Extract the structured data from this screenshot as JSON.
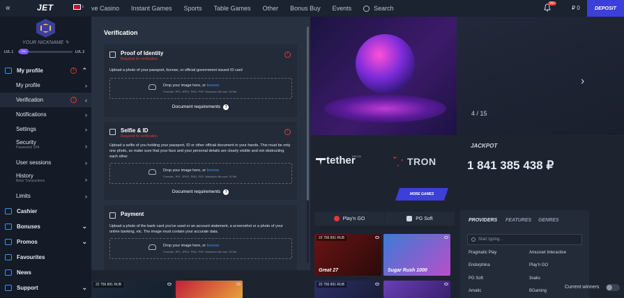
{
  "header": {
    "logo": "JET",
    "nav": [
      "ve Casino",
      "Instant Games",
      "Sports",
      "Table Games",
      "Other",
      "Bonus Buy",
      "Events"
    ],
    "search": "Search",
    "notif_badge": "99+",
    "balance": "₽ 0",
    "deposit": "DEPOSIT"
  },
  "profile": {
    "nickname": "YOUR NICKNAME",
    "lvl_left": "LVL 1",
    "lvl_right": "LVL 2",
    "lvl_pill": "0%",
    "progress": 0.07
  },
  "sidebar": {
    "my_profile": "My profile",
    "sub": [
      {
        "label": "My profile"
      },
      {
        "label": "Verification"
      },
      {
        "label": "Notifications"
      },
      {
        "label": "Settings"
      },
      {
        "label": "Security",
        "sub": "Password/ 2FA"
      },
      {
        "label": "User sessions"
      },
      {
        "label": "History",
        "sub": "Bets/ Transactions"
      },
      {
        "label": "Limits"
      }
    ],
    "main": [
      "Cashier",
      "Bonuses",
      "Promos",
      "Favourites",
      "News",
      "Support"
    ]
  },
  "verification": {
    "title": "Verification",
    "cards": [
      {
        "title": "Proof of Identity",
        "required": "Required for verification",
        "desc": "Upload a photo of your passport, license, or official government issued ID card",
        "drop": "Drop your image here, or",
        "browse": "browse",
        "formats": "Formats: JPG, JPEG, PNG, PDF. Maximum file size: 30 Mb",
        "doc_req": "Document requirements"
      },
      {
        "title": "Selfie & ID",
        "required": "Required for verification",
        "desc": "Upload a selfie of you holding your passport, ID or other official document in your hands. This must be only one photo, so make sure that your face and your personal details are clearly visible and not obstructing each other.",
        "drop": "Drop your image here, or",
        "browse": "browse",
        "formats": "Formats: JPG, JPEG, PNG, PDF. Maximum file size: 30 Mb",
        "doc_req": "Document requirements"
      },
      {
        "title": "Payment",
        "desc": "Upload a photo of the bank card you've used or an account statement, a screenshot or a photo of your online banking, etc. The image must contain your accurate data.",
        "drop": "Drop your image here, or",
        "browse": "browse",
        "formats": "Formats: JPG, JPEG, PNG, PDF. Maximum file size: 30 Mb"
      }
    ]
  },
  "banner": {
    "counter": "4 / 15",
    "tether": "tether",
    "erc": "ERC20",
    "tron": "TRON"
  },
  "jackpot": {
    "label": "JACKPOT",
    "value": "1 841 385 438 ₽"
  },
  "more_games": "MORE GAMES",
  "providers_tabs": [
    "Play'n GO",
    "PG Soft"
  ],
  "games": [
    {
      "badge": "22 756 891 RUB",
      "name": "Great 27"
    },
    {
      "badge": "",
      "name": "Sugar Rush 1000"
    },
    {
      "badge": "22 756 891 RUB",
      "name": ""
    },
    {
      "badge": "",
      "name": ""
    },
    {
      "badge": "22 756 891 RUB",
      "name": ""
    },
    {
      "badge": "",
      "name": ""
    }
  ],
  "provider_filter": {
    "tabs": [
      "PROVIDERS",
      "FEATURES",
      "GENRES"
    ],
    "search_placeholder": "Start typing...",
    "items": [
      "Pragmatic Play",
      "Amusnet Interactive",
      "Endorphina",
      "Play'n GO",
      "PG Soft",
      "3oaks",
      "Amatic",
      "BGaming"
    ]
  },
  "current_winners": "Current winners"
}
